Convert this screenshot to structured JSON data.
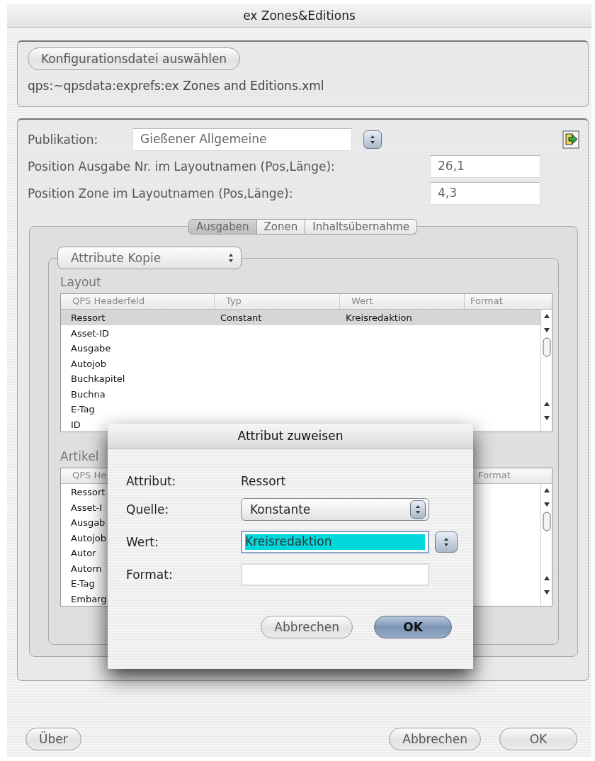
{
  "window": {
    "title": "ex Zones&Editions"
  },
  "config": {
    "button": "Konfigurationsdatei auswählen",
    "path": "qps:~qpsdata:exprefs:ex Zones and Editions.xml"
  },
  "publikation": {
    "label": "Publikation:",
    "value": "Gießener Allgemeine"
  },
  "position_fields": [
    {
      "label": "Position Ausgabe Nr. im Layoutnamen (Pos,Länge):",
      "value": "26,1"
    },
    {
      "label": "Position Zone im Layoutnamen (Pos,Länge):",
      "value": "4,3"
    }
  ],
  "tabs": [
    {
      "label": "Ausgaben",
      "selected": true
    },
    {
      "label": "Zonen",
      "selected": false
    },
    {
      "label": "Inhaltsübernahme",
      "selected": false
    }
  ],
  "mode_popup": {
    "value": "Attribute Kopie"
  },
  "layout": {
    "title": "Layout",
    "columns": [
      "QPS Headerfeld",
      "Typ",
      "Wert",
      "Format"
    ],
    "rows": [
      {
        "cells": [
          "Ressort",
          "Constant",
          "Kreisredaktion"
        ],
        "selected": true
      },
      {
        "cells": [
          "Asset-ID"
        ],
        "selected": false
      },
      {
        "cells": [
          "Ausgabe"
        ],
        "selected": false
      },
      {
        "cells": [
          "Autojob"
        ],
        "selected": false
      },
      {
        "cells": [
          "Buchkapitel"
        ],
        "selected": false
      },
      {
        "cells": [
          "Buchna"
        ],
        "selected": false
      },
      {
        "cells": [
          "E-Tag"
        ],
        "selected": false
      },
      {
        "cells": [
          "ID"
        ],
        "selected": false
      }
    ]
  },
  "artikel": {
    "title": "Artikel",
    "columns": [
      "QPS He",
      "Format"
    ],
    "rows": [
      {
        "cells": [
          "Ressort"
        ],
        "selected": false
      },
      {
        "cells": [
          "Asset-I"
        ],
        "selected": false
      },
      {
        "cells": [
          "Ausgab"
        ],
        "selected": false
      },
      {
        "cells": [
          "Autojob"
        ],
        "selected": false
      },
      {
        "cells": [
          "Autor"
        ],
        "selected": false
      },
      {
        "cells": [
          "Autorn"
        ],
        "selected": false
      },
      {
        "cells": [
          "E-Tag"
        ],
        "selected": false
      },
      {
        "cells": [
          "Embarg"
        ],
        "selected": false
      }
    ]
  },
  "buttons": [
    {
      "label": "Über"
    },
    {
      "label": "Abbrechen"
    },
    {
      "label": "OK"
    }
  ],
  "dialog": {
    "title": "Attribut zuweisen",
    "attribut": {
      "label": "Attribut:",
      "value": "Ressort"
    },
    "quelle": {
      "label": "Quelle:",
      "value": "Konstante"
    },
    "wert": {
      "label": "Wert:",
      "value": "Kreisredaktion",
      "highlighted": true
    },
    "format": {
      "label": "Format:"
    },
    "buttons": [
      {
        "label": "Abbrechen",
        "kind": "normal"
      },
      {
        "label": "OK",
        "kind": "default"
      }
    ]
  }
}
